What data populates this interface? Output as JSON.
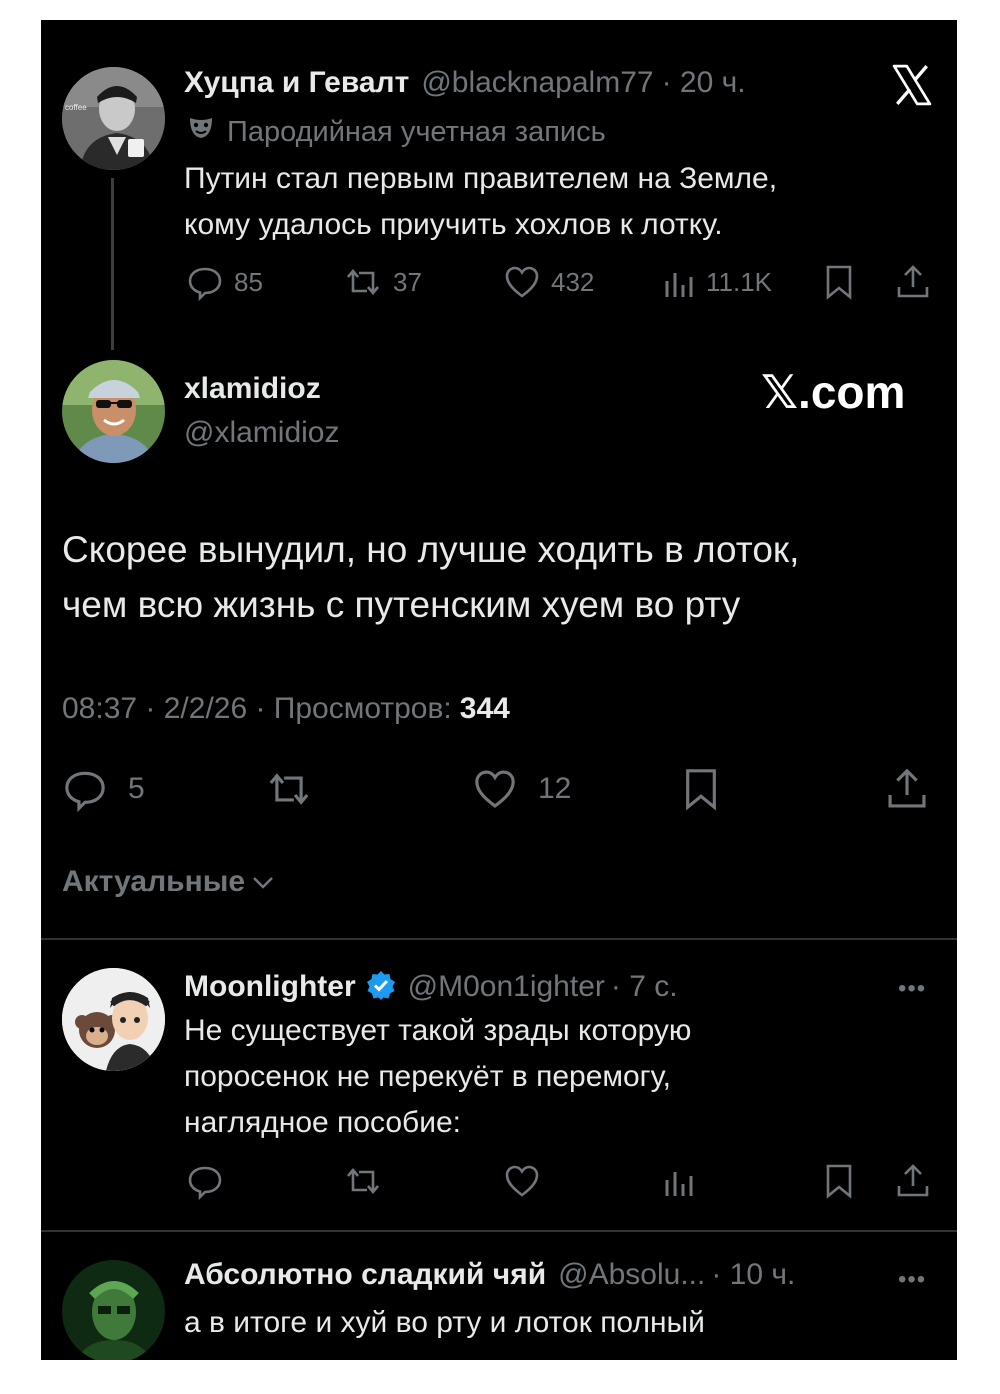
{
  "quoted_tweet": {
    "author_name": "Хуцпа и Гевалт",
    "handle": "@blacknapalm77",
    "time": "· 20 ч.",
    "parody_label": "Пародийная учетная запись",
    "text_line1": "Путин стал первым правителем на Земле,",
    "text_line2": "кому удалось приучить хохлов к лотку.",
    "stats": {
      "replies": "85",
      "retweets": "37",
      "likes": "432",
      "views": "11.1K"
    },
    "avatar_cup_text": "coffee"
  },
  "main_tweet": {
    "author_name": "xlamidioz",
    "handle": "@xlamidioz",
    "watermark": "𝕏.com",
    "text_line1": "Скорее вынудил, но лучше ходить в лоток,",
    "text_line2": "чем всю жизнь с путенским хуем во рту",
    "meta": "08:37 · 2/2/26 · Просмотров:",
    "views": "344",
    "stats": {
      "replies": "5",
      "likes": "12"
    }
  },
  "sort": {
    "label": "Актуальные"
  },
  "replies": [
    {
      "author_name": "Moonlighter",
      "handle": "@M0on1ighter",
      "time": "· 7 с.",
      "text_line1": "Не существует такой зрады которую",
      "text_line2": "поросенок не перекуёт в перемогу,",
      "text_line3": "наглядное пособие:",
      "verified": true
    },
    {
      "author_name": "Абсолютно сладкий чяй",
      "handle": "@Absolu...",
      "time": "· 10 ч.",
      "text_line1": "а в итоге и хуй во рту и лоток полный"
    }
  ],
  "colors": {
    "background": "#000000",
    "text": "#e7e9ea",
    "muted": "#71767b",
    "verified": "#1d9bf0",
    "divider": "#2f3336"
  }
}
